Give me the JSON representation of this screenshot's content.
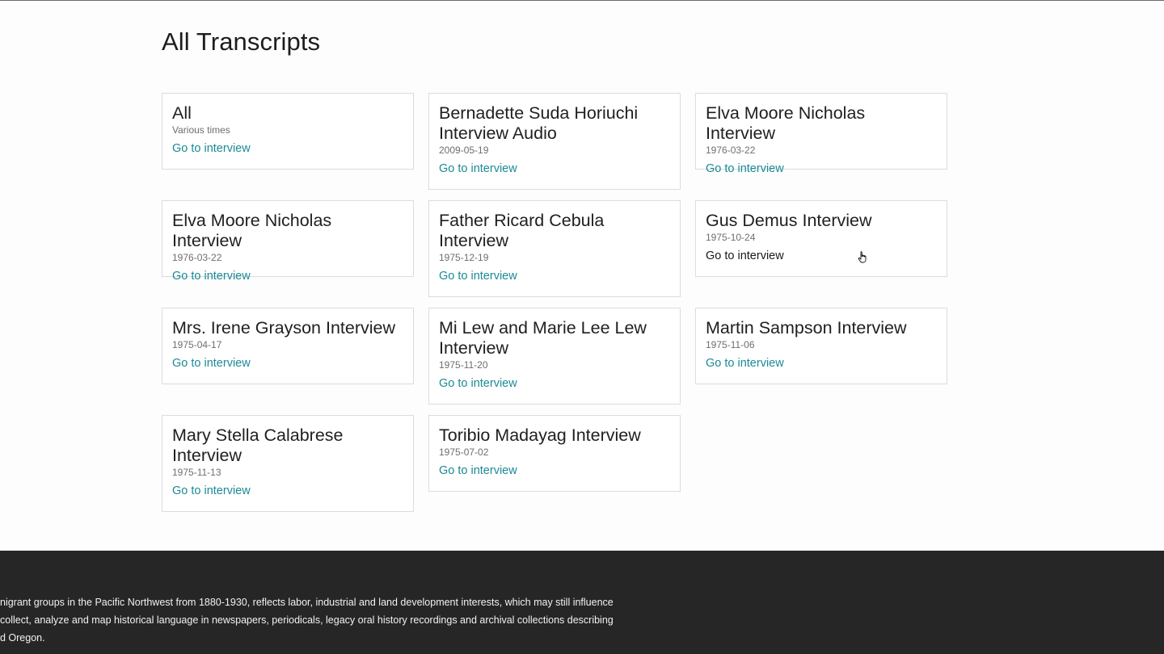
{
  "page": {
    "title": "All Transcripts"
  },
  "cards": [
    {
      "title": "All",
      "date": "Various times",
      "link": "Go to interview"
    },
    {
      "title": "Bernadette Suda Horiuchi Interview Audio",
      "date": "2009-05-19",
      "link": "Go to interview"
    },
    {
      "title": "Elva Moore Nicholas Interview",
      "date": "1976-03-22",
      "link": "Go to interview"
    },
    {
      "title": "Elva Moore Nicholas Interview",
      "date": "1976-03-22",
      "link": "Go to interview"
    },
    {
      "title": "Father Ricard Cebula Interview",
      "date": "1975-12-19",
      "link": "Go to interview"
    },
    {
      "title": "Gus Demus Interview",
      "date": "1975-10-24",
      "link": "Go to interview"
    },
    {
      "title": "Mrs. Irene Grayson Interview",
      "date": "1975-04-17",
      "link": "Go to interview"
    },
    {
      "title": "Mi Lew and Marie Lee Lew Interview",
      "date": "1975-11-20",
      "link": "Go to interview"
    },
    {
      "title": "Martin Sampson Interview",
      "date": "1975-11-06",
      "link": "Go to interview"
    },
    {
      "title": "Mary Stella Calabrese Interview",
      "date": "1975-11-13",
      "link": "Go to interview"
    },
    {
      "title": "Toribio Madayag Interview",
      "date": "1975-07-02",
      "link": "Go to interview"
    }
  ],
  "footer": {
    "lines": [
      "nigrant groups in the Pacific Northwest from 1880-1930, reflects labor, industrial and land development interests, which may still influence",
      "collect, analyze and map historical language in newspapers, periodicals, legacy oral history recordings and archival collections describing",
      "d Oregon."
    ]
  },
  "colors": {
    "link": "#1a8a95",
    "footer_bg": "#262626",
    "card_border": "#dcdcdc"
  }
}
